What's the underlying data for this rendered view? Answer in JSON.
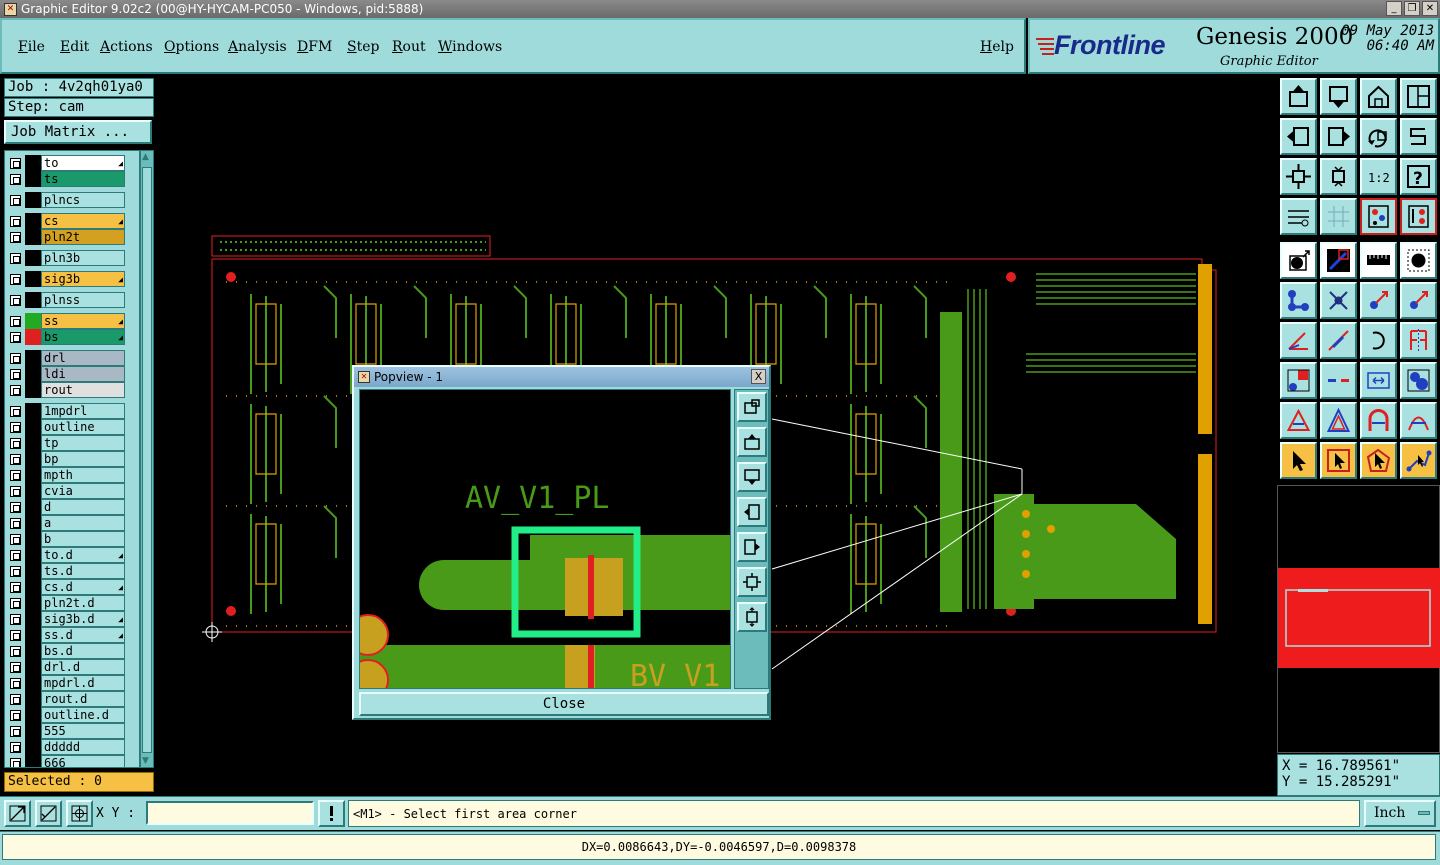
{
  "window": {
    "title": "Graphic Editor 9.02c2 (00@HY-HYCAM-PC050 - Windows, pid:5888)"
  },
  "menu": {
    "file": "File",
    "edit": "Edit",
    "actions": "Actions",
    "options": "Options",
    "analysis": "Analysis",
    "dfm": "DFM",
    "step": "Step",
    "rout": "Rout",
    "windows": "Windows",
    "help": "Help"
  },
  "brand": {
    "logo": "Frontline",
    "product": "Genesis 2000",
    "subtitle": "Graphic Editor",
    "date": "09 May 2013",
    "time": "06:40 AM"
  },
  "job": {
    "job_label": "Job : 4v2qh01ya0",
    "step_label": "Step: cam",
    "matrix_button": "Job Matrix ..."
  },
  "layers": [
    {
      "name": "to",
      "color": "#ffffff",
      "swatch": "#000000",
      "selectable": true
    },
    {
      "name": "ts",
      "color": "#1a9a6a",
      "swatch": "#000000",
      "selectable": false
    },
    {
      "name": "plncs",
      "color": "#a9e0e0",
      "swatch": "#000000",
      "selectable": false
    },
    {
      "name": "cs",
      "color": "#f5c044",
      "swatch": "#000000",
      "selectable": true
    },
    {
      "name": "pln2t",
      "color": "#d4a020",
      "swatch": "#000000",
      "selectable": false
    },
    {
      "name": "pln3b",
      "color": "#a9e0e0",
      "swatch": "#000000",
      "selectable": false
    },
    {
      "name": "sig3b",
      "color": "#f5c044",
      "swatch": "#000000",
      "selectable": true
    },
    {
      "name": "plnss",
      "color": "#a9e0e0",
      "swatch": "#000000",
      "selectable": false
    },
    {
      "name": "ss",
      "color": "#f5c044",
      "swatch": "#22aa22",
      "selectable": true
    },
    {
      "name": "bs",
      "color": "#1a9a6a",
      "swatch": "#e02020",
      "selectable": true
    },
    {
      "name": "drl",
      "color": "#a8b8c4",
      "swatch": "#000000",
      "selectable": false
    },
    {
      "name": "ldi",
      "color": "#a8b8c4",
      "swatch": "#000000",
      "selectable": false
    },
    {
      "name": "rout",
      "color": "#e0e0e0",
      "swatch": "#000000",
      "selectable": false
    },
    {
      "name": "1mpdrl",
      "color": "#a9e0e0",
      "swatch": "#000000",
      "selectable": false
    },
    {
      "name": "outline",
      "color": "#a9e0e0",
      "swatch": "#000000",
      "selectable": false
    },
    {
      "name": "tp",
      "color": "#a9e0e0",
      "swatch": "#000000",
      "selectable": false
    },
    {
      "name": "bp",
      "color": "#a9e0e0",
      "swatch": "#000000",
      "selectable": false
    },
    {
      "name": "mpth",
      "color": "#a9e0e0",
      "swatch": "#000000",
      "selectable": false
    },
    {
      "name": "cvia",
      "color": "#a9e0e0",
      "swatch": "#000000",
      "selectable": false
    },
    {
      "name": "d",
      "color": "#a9e0e0",
      "swatch": "#000000",
      "selectable": false
    },
    {
      "name": "a",
      "color": "#a9e0e0",
      "swatch": "#000000",
      "selectable": false
    },
    {
      "name": "b",
      "color": "#a9e0e0",
      "swatch": "#000000",
      "selectable": false
    },
    {
      "name": "to.d",
      "color": "#a9e0e0",
      "swatch": "#000000",
      "selectable": true
    },
    {
      "name": "ts.d",
      "color": "#a9e0e0",
      "swatch": "#000000",
      "selectable": false
    },
    {
      "name": "cs.d",
      "color": "#a9e0e0",
      "swatch": "#000000",
      "selectable": true
    },
    {
      "name": "pln2t.d",
      "color": "#a9e0e0",
      "swatch": "#000000",
      "selectable": false
    },
    {
      "name": "sig3b.d",
      "color": "#a9e0e0",
      "swatch": "#000000",
      "selectable": true
    },
    {
      "name": "ss.d",
      "color": "#a9e0e0",
      "swatch": "#000000",
      "selectable": true
    },
    {
      "name": "bs.d",
      "color": "#a9e0e0",
      "swatch": "#000000",
      "selectable": false
    },
    {
      "name": "drl.d",
      "color": "#a9e0e0",
      "swatch": "#000000",
      "selectable": false
    },
    {
      "name": "mpdrl.d",
      "color": "#a9e0e0",
      "swatch": "#000000",
      "selectable": false
    },
    {
      "name": "rout.d",
      "color": "#a9e0e0",
      "swatch": "#000000",
      "selectable": false
    },
    {
      "name": "outline.d",
      "color": "#a9e0e0",
      "swatch": "#000000",
      "selectable": false
    },
    {
      "name": "555",
      "color": "#a9e0e0",
      "swatch": "#000000",
      "selectable": false
    },
    {
      "name": "ddddd",
      "color": "#a9e0e0",
      "swatch": "#000000",
      "selectable": false
    },
    {
      "name": "666",
      "color": "#a9e0e0",
      "swatch": "#000000",
      "selectable": false
    }
  ],
  "selected": "Selected : 0",
  "coords": {
    "x": "X = 16.789561\"",
    "y": "Y = 15.285291\""
  },
  "popview": {
    "title": "Popview - 1",
    "close_x": "X",
    "close_button": "Close",
    "label_top": "AV_V1_PL",
    "label_bottom": "BV_V1"
  },
  "cmdbar": {
    "xy_label": "X Y :",
    "xy_value": "",
    "prompt": "<M1> - Select first area corner",
    "units": "Inch"
  },
  "status": "DX=0.0086643,DY=-0.0046597,D=0.0098378",
  "colors": {
    "panel": "#9fdbdb",
    "copper": "#4a9a1a",
    "outline": "#e02020",
    "highlight": "#22ee88"
  }
}
